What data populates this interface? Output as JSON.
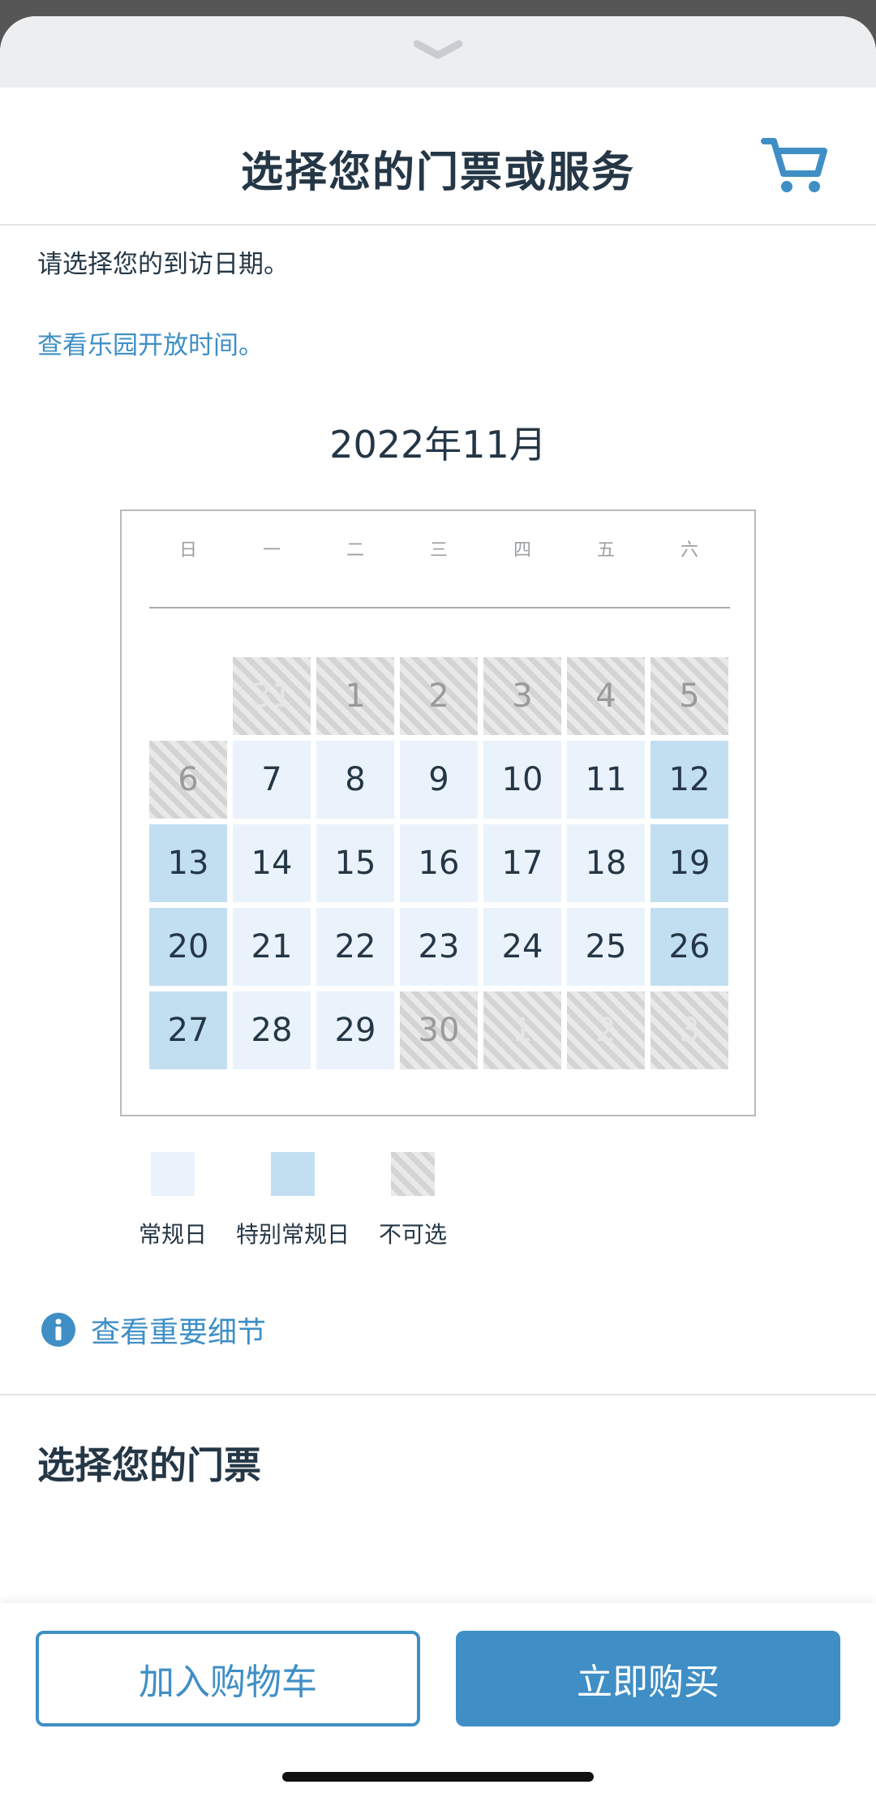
{
  "header": {
    "title": "选择您的门票或服务",
    "cart_icon": "shopping-cart-icon",
    "collapse_icon": "chevron-down-icon"
  },
  "intro": "请选择您的到访日期。",
  "park_hours_link": "查看乐园开放时间。",
  "calendar": {
    "month_label": "2022年11月",
    "weekdays": [
      "日",
      "一",
      "二",
      "三",
      "四",
      "五",
      "六"
    ],
    "weeks": [
      [
        {
          "d": "",
          "s": "blank"
        },
        {
          "d": "31",
          "s": "na_other"
        },
        {
          "d": "1",
          "s": "na"
        },
        {
          "d": "2",
          "s": "na"
        },
        {
          "d": "3",
          "s": "na"
        },
        {
          "d": "4",
          "s": "na"
        },
        {
          "d": "5",
          "s": "na"
        }
      ],
      [
        {
          "d": "6",
          "s": "na"
        },
        {
          "d": "7",
          "s": "regular"
        },
        {
          "d": "8",
          "s": "regular"
        },
        {
          "d": "9",
          "s": "regular"
        },
        {
          "d": "10",
          "s": "regular"
        },
        {
          "d": "11",
          "s": "regular"
        },
        {
          "d": "12",
          "s": "special"
        }
      ],
      [
        {
          "d": "13",
          "s": "special"
        },
        {
          "d": "14",
          "s": "regular"
        },
        {
          "d": "15",
          "s": "regular"
        },
        {
          "d": "16",
          "s": "regular"
        },
        {
          "d": "17",
          "s": "regular"
        },
        {
          "d": "18",
          "s": "regular"
        },
        {
          "d": "19",
          "s": "special"
        }
      ],
      [
        {
          "d": "20",
          "s": "special"
        },
        {
          "d": "21",
          "s": "regular"
        },
        {
          "d": "22",
          "s": "regular"
        },
        {
          "d": "23",
          "s": "regular"
        },
        {
          "d": "24",
          "s": "regular"
        },
        {
          "d": "25",
          "s": "regular"
        },
        {
          "d": "26",
          "s": "special"
        }
      ],
      [
        {
          "d": "27",
          "s": "special"
        },
        {
          "d": "28",
          "s": "regular"
        },
        {
          "d": "29",
          "s": "regular"
        },
        {
          "d": "30",
          "s": "na"
        },
        {
          "d": "1",
          "s": "na_other"
        },
        {
          "d": "2",
          "s": "na_other"
        },
        {
          "d": "3",
          "s": "na_other"
        }
      ]
    ]
  },
  "legend": {
    "regular": "常规日",
    "special": "特别常规日",
    "unavailable": "不可选"
  },
  "important_details_link": "查看重要细节",
  "tickets_section_title": "选择您的门票",
  "footer": {
    "add_to_cart": "加入购物车",
    "buy_now": "立即购买"
  },
  "colors": {
    "accent": "#3f8fc6",
    "regular_day": "#eaf3fb",
    "special_day": "#c2dff2",
    "text_dark": "#253746"
  }
}
